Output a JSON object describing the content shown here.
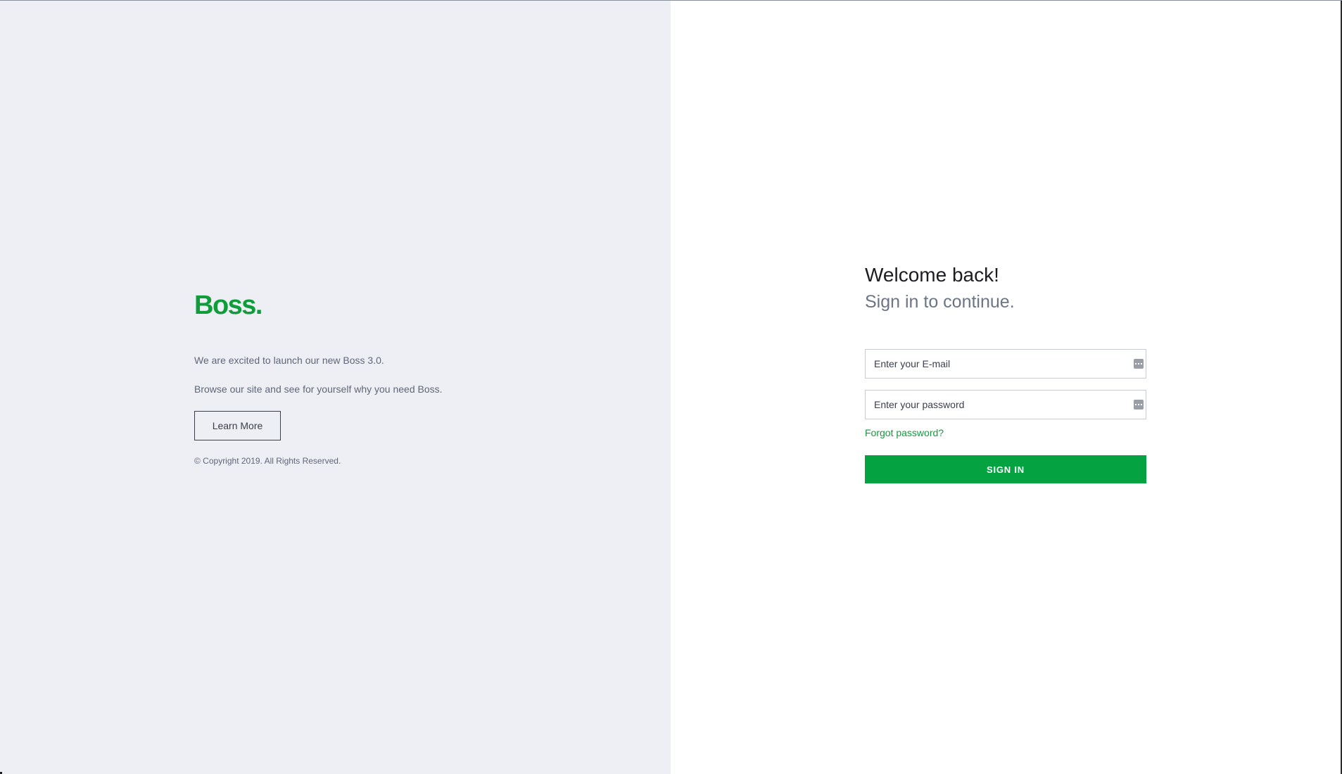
{
  "brand": {
    "logo_text": "Boss."
  },
  "left": {
    "intro_line_1": "We are excited to launch our new Boss 3.0.",
    "intro_line_2": "Browse our site and see for yourself why you need Boss.",
    "learn_more_label": "Learn More",
    "copyright": "© Copyright 2019. All Rights Reserved."
  },
  "login": {
    "title": "Welcome back!",
    "subtitle": "Sign in to continue.",
    "email_placeholder": "Enter your E-mail",
    "email_value": "",
    "password_placeholder": "Enter your password",
    "password_value": "",
    "forgot_label": "Forgot password?",
    "signin_label": "SIGN IN"
  },
  "icons": {
    "email_field_icon": "password-manager-key-icon",
    "password_field_icon": "password-manager-key-icon"
  },
  "colors": {
    "brand_green": "#0f9d3c",
    "button_green": "#05a241",
    "left_background": "#eeeff4",
    "right_background": "#ffffff"
  }
}
